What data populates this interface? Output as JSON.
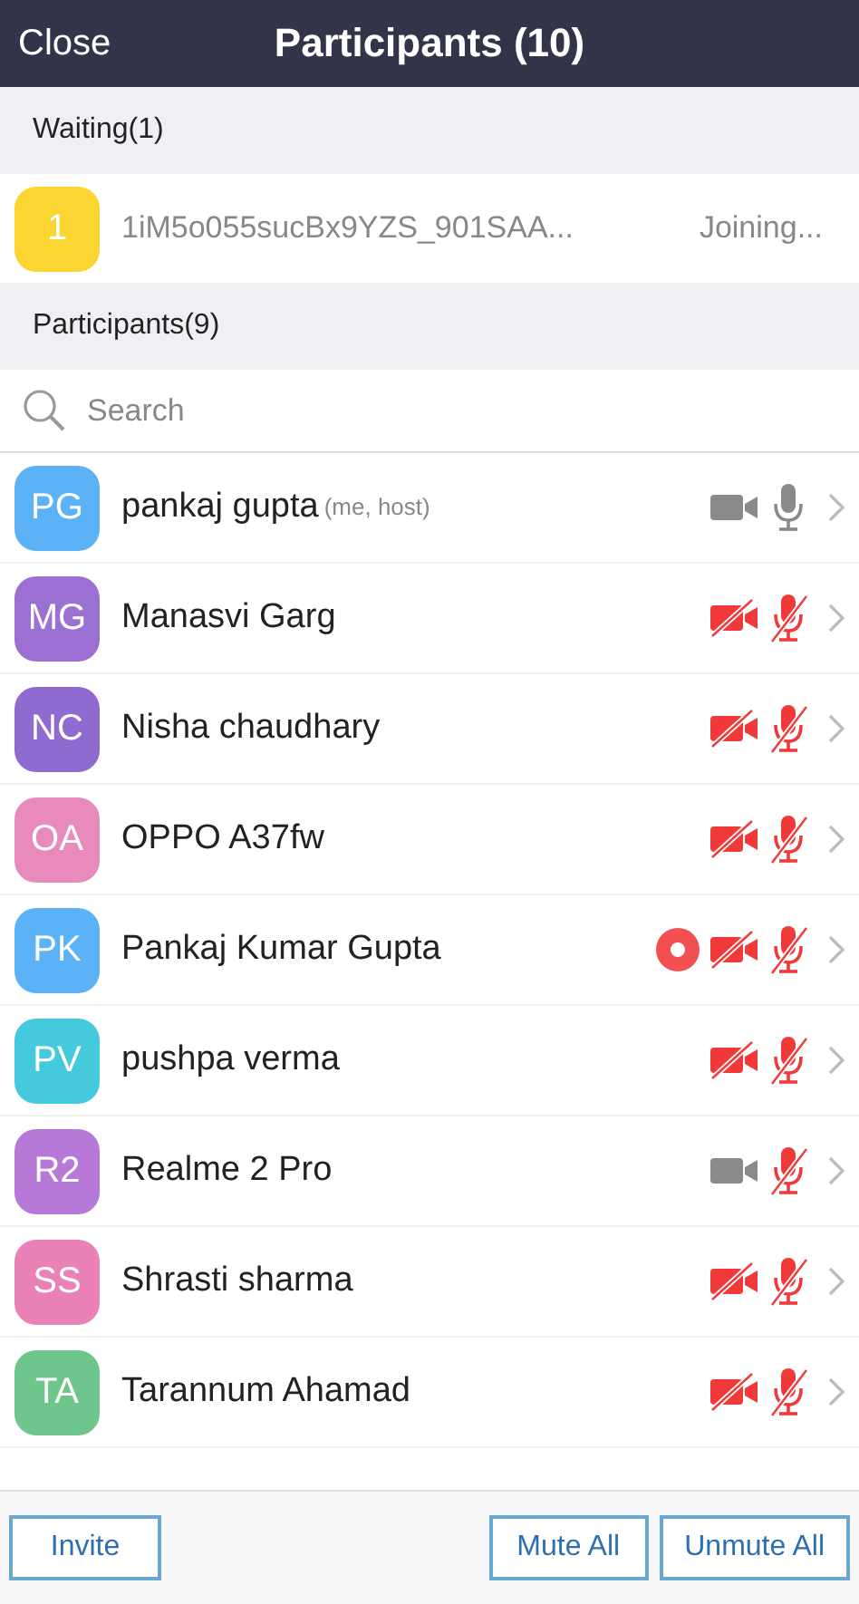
{
  "header": {
    "close": "Close",
    "title": "Participants (10)"
  },
  "waiting": {
    "heading": "Waiting(1)",
    "items": [
      {
        "avatar": "1",
        "color": "#fbd632",
        "name": "1iM5o055sucBx9YZS_901SAA...",
        "status": "Joining..."
      }
    ]
  },
  "participants": {
    "heading": "Participants(9)",
    "search": {
      "placeholder": "Search"
    },
    "items": [
      {
        "initials": "PG",
        "color": "#5cb2f6",
        "name": "pankaj gupta",
        "note": "(me, host)",
        "recording": false,
        "video_on": true,
        "audio_on": true
      },
      {
        "initials": "MG",
        "color": "#9c6fd2",
        "name": "Manasvi Garg",
        "recording": false,
        "video_on": false,
        "audio_on": false
      },
      {
        "initials": "NC",
        "color": "#8f6bd0",
        "name": "Nisha chaudhary",
        "recording": false,
        "video_on": false,
        "audio_on": false
      },
      {
        "initials": "OA",
        "color": "#e88bbc",
        "name": "OPPO A37fw",
        "recording": false,
        "video_on": false,
        "audio_on": false
      },
      {
        "initials": "PK",
        "color": "#5cb2f6",
        "name": "Pankaj Kumar Gupta",
        "recording": true,
        "video_on": false,
        "audio_on": false
      },
      {
        "initials": "PV",
        "color": "#45c9dc",
        "name": "pushpa verma",
        "recording": false,
        "video_on": false,
        "audio_on": false
      },
      {
        "initials": "R2",
        "color": "#b779d8",
        "name": "Realme 2 Pro",
        "recording": false,
        "video_on": true,
        "audio_on": false
      },
      {
        "initials": "SS",
        "color": "#ea82b7",
        "name": "Shrasti sharma",
        "recording": false,
        "video_on": false,
        "audio_on": false
      },
      {
        "initials": "TA",
        "color": "#6fc68c",
        "name": "Tarannum Ahamad",
        "recording": false,
        "video_on": false,
        "audio_on": false
      }
    ]
  },
  "footer": {
    "buttons": [
      {
        "label": "Invite",
        "kind": "left"
      },
      {
        "label": "Mute All",
        "kind": "right"
      },
      {
        "label": "Unmute All",
        "kind": "right"
      }
    ]
  }
}
